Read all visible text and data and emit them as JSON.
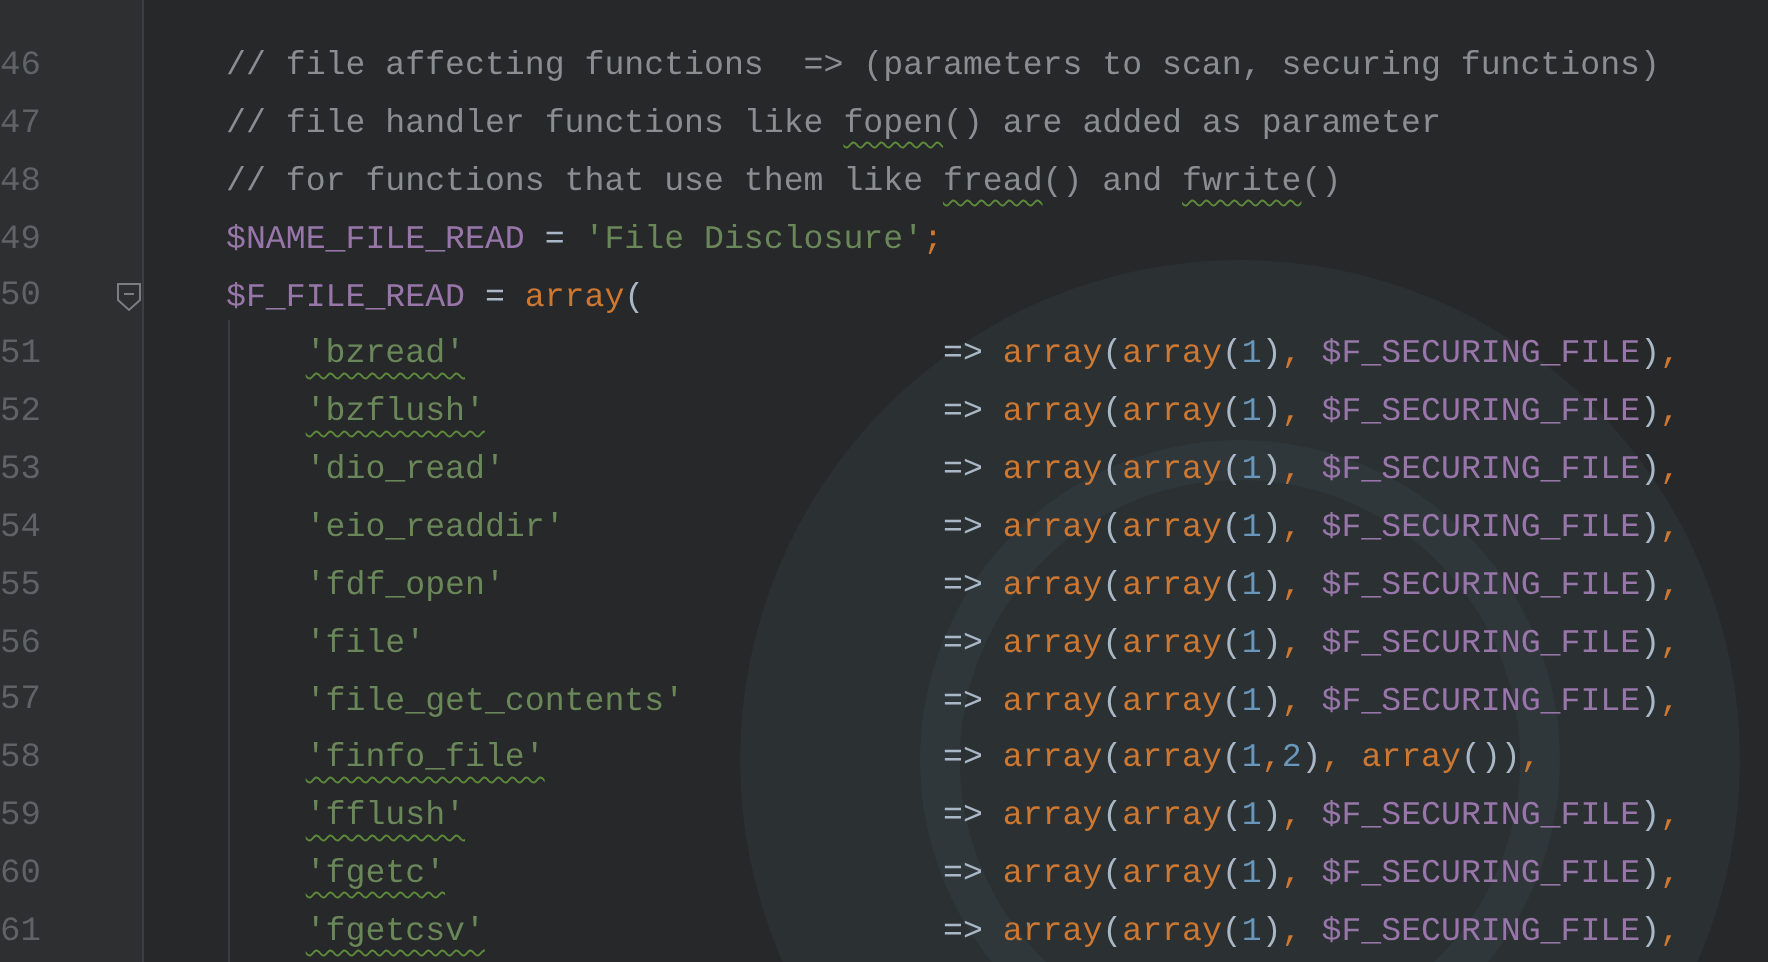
{
  "editor": {
    "lines": [
      {
        "number": "46",
        "fold_marker": false,
        "tokens": [
          {
            "kind": "comment",
            "text": "// file affecting functions  => (parameters to scan, securing functions)"
          }
        ]
      },
      {
        "number": "47",
        "fold_marker": false,
        "tokens": [
          {
            "kind": "comment",
            "text": "// file handler functions like "
          },
          {
            "kind": "flagged_comment",
            "text": "fopen"
          },
          {
            "kind": "comment",
            "text": "() are added as parameter"
          }
        ]
      },
      {
        "number": "48",
        "fold_marker": false,
        "tokens": [
          {
            "kind": "comment",
            "text": "// for functions that use them like "
          },
          {
            "kind": "flagged_comment",
            "text": "fread"
          },
          {
            "kind": "comment",
            "text": "() and "
          },
          {
            "kind": "flagged_comment",
            "text": "fwrite"
          },
          {
            "kind": "comment",
            "text": "()"
          }
        ]
      },
      {
        "number": "49",
        "fold_marker": false,
        "tokens": [
          {
            "kind": "variable",
            "text": "$NAME_FILE_READ"
          },
          {
            "kind": "plain",
            "text": " = "
          },
          {
            "kind": "string",
            "text": "'File Disclosure'"
          },
          {
            "kind": "keyword",
            "text": ";"
          }
        ]
      },
      {
        "number": "50",
        "fold_marker": true,
        "tokens": [
          {
            "kind": "variable",
            "text": "$F_FILE_READ"
          },
          {
            "kind": "plain",
            "text": " = "
          },
          {
            "kind": "keyword",
            "text": "array"
          },
          {
            "kind": "plain",
            "text": "("
          }
        ]
      },
      {
        "number": "51",
        "fold_marker": false,
        "tokens": [
          {
            "kind": "flagged_string",
            "text": "'bzread'"
          },
          {
            "kind": "plain",
            "text": "                        => "
          },
          {
            "kind": "keyword",
            "text": "array"
          },
          {
            "kind": "plain",
            "text": "("
          },
          {
            "kind": "keyword",
            "text": "array"
          },
          {
            "kind": "plain",
            "text": "("
          },
          {
            "kind": "number",
            "text": "1"
          },
          {
            "kind": "plain",
            "text": ")"
          },
          {
            "kind": "keyword",
            "text": ", "
          },
          {
            "kind": "variable",
            "text": "$F_SECURING_FILE"
          },
          {
            "kind": "plain",
            "text": ")"
          },
          {
            "kind": "keyword",
            "text": ","
          }
        ]
      },
      {
        "number": "52",
        "fold_marker": false,
        "tokens": [
          {
            "kind": "flagged_string",
            "text": "'bzflush'"
          },
          {
            "kind": "plain",
            "text": "                       => "
          },
          {
            "kind": "keyword",
            "text": "array"
          },
          {
            "kind": "plain",
            "text": "("
          },
          {
            "kind": "keyword",
            "text": "array"
          },
          {
            "kind": "plain",
            "text": "("
          },
          {
            "kind": "number",
            "text": "1"
          },
          {
            "kind": "plain",
            "text": ")"
          },
          {
            "kind": "keyword",
            "text": ", "
          },
          {
            "kind": "variable",
            "text": "$F_SECURING_FILE"
          },
          {
            "kind": "plain",
            "text": ")"
          },
          {
            "kind": "keyword",
            "text": ","
          }
        ]
      },
      {
        "number": "53",
        "fold_marker": false,
        "tokens": [
          {
            "kind": "string",
            "text": "'dio_read'"
          },
          {
            "kind": "plain",
            "text": "                      => "
          },
          {
            "kind": "keyword",
            "text": "array"
          },
          {
            "kind": "plain",
            "text": "("
          },
          {
            "kind": "keyword",
            "text": "array"
          },
          {
            "kind": "plain",
            "text": "("
          },
          {
            "kind": "number",
            "text": "1"
          },
          {
            "kind": "plain",
            "text": ")"
          },
          {
            "kind": "keyword",
            "text": ", "
          },
          {
            "kind": "variable",
            "text": "$F_SECURING_FILE"
          },
          {
            "kind": "plain",
            "text": ")"
          },
          {
            "kind": "keyword",
            "text": ","
          }
        ]
      },
      {
        "number": "54",
        "fold_marker": false,
        "tokens": [
          {
            "kind": "string",
            "text": "'eio_readdir'"
          },
          {
            "kind": "plain",
            "text": "                   => "
          },
          {
            "kind": "keyword",
            "text": "array"
          },
          {
            "kind": "plain",
            "text": "("
          },
          {
            "kind": "keyword",
            "text": "array"
          },
          {
            "kind": "plain",
            "text": "("
          },
          {
            "kind": "number",
            "text": "1"
          },
          {
            "kind": "plain",
            "text": ")"
          },
          {
            "kind": "keyword",
            "text": ", "
          },
          {
            "kind": "variable",
            "text": "$F_SECURING_FILE"
          },
          {
            "kind": "plain",
            "text": ")"
          },
          {
            "kind": "keyword",
            "text": ","
          }
        ]
      },
      {
        "number": "55",
        "fold_marker": false,
        "tokens": [
          {
            "kind": "string",
            "text": "'fdf_open'"
          },
          {
            "kind": "plain",
            "text": "                      => "
          },
          {
            "kind": "keyword",
            "text": "array"
          },
          {
            "kind": "plain",
            "text": "("
          },
          {
            "kind": "keyword",
            "text": "array"
          },
          {
            "kind": "plain",
            "text": "("
          },
          {
            "kind": "number",
            "text": "1"
          },
          {
            "kind": "plain",
            "text": ")"
          },
          {
            "kind": "keyword",
            "text": ", "
          },
          {
            "kind": "variable",
            "text": "$F_SECURING_FILE"
          },
          {
            "kind": "plain",
            "text": ")"
          },
          {
            "kind": "keyword",
            "text": ","
          }
        ]
      },
      {
        "number": "56",
        "fold_marker": false,
        "tokens": [
          {
            "kind": "string",
            "text": "'file'"
          },
          {
            "kind": "plain",
            "text": "                          => "
          },
          {
            "kind": "keyword",
            "text": "array"
          },
          {
            "kind": "plain",
            "text": "("
          },
          {
            "kind": "keyword",
            "text": "array"
          },
          {
            "kind": "plain",
            "text": "("
          },
          {
            "kind": "number",
            "text": "1"
          },
          {
            "kind": "plain",
            "text": ")"
          },
          {
            "kind": "keyword",
            "text": ", "
          },
          {
            "kind": "variable",
            "text": "$F_SECURING_FILE"
          },
          {
            "kind": "plain",
            "text": ")"
          },
          {
            "kind": "keyword",
            "text": ","
          }
        ]
      },
      {
        "number": "57",
        "fold_marker": false,
        "tokens": [
          {
            "kind": "string",
            "text": "'file_get_contents'"
          },
          {
            "kind": "plain",
            "text": "             => "
          },
          {
            "kind": "keyword",
            "text": "array"
          },
          {
            "kind": "plain",
            "text": "("
          },
          {
            "kind": "keyword",
            "text": "array"
          },
          {
            "kind": "plain",
            "text": "("
          },
          {
            "kind": "number",
            "text": "1"
          },
          {
            "kind": "plain",
            "text": ")"
          },
          {
            "kind": "keyword",
            "text": ", "
          },
          {
            "kind": "variable",
            "text": "$F_SECURING_FILE"
          },
          {
            "kind": "plain",
            "text": ")"
          },
          {
            "kind": "keyword",
            "text": ","
          }
        ]
      },
      {
        "number": "58",
        "fold_marker": false,
        "tokens": [
          {
            "kind": "flagged_string",
            "text": "'finfo_file'"
          },
          {
            "kind": "plain",
            "text": "                    => "
          },
          {
            "kind": "keyword",
            "text": "array"
          },
          {
            "kind": "plain",
            "text": "("
          },
          {
            "kind": "keyword",
            "text": "array"
          },
          {
            "kind": "plain",
            "text": "("
          },
          {
            "kind": "number",
            "text": "1"
          },
          {
            "kind": "keyword",
            "text": ","
          },
          {
            "kind": "number",
            "text": "2"
          },
          {
            "kind": "plain",
            "text": ")"
          },
          {
            "kind": "keyword",
            "text": ", "
          },
          {
            "kind": "keyword",
            "text": "array"
          },
          {
            "kind": "plain",
            "text": "())"
          },
          {
            "kind": "keyword",
            "text": ","
          }
        ]
      },
      {
        "number": "59",
        "fold_marker": false,
        "tokens": [
          {
            "kind": "flagged_string",
            "text": "'fflush'"
          },
          {
            "kind": "plain",
            "text": "                        => "
          },
          {
            "kind": "keyword",
            "text": "array"
          },
          {
            "kind": "plain",
            "text": "("
          },
          {
            "kind": "keyword",
            "text": "array"
          },
          {
            "kind": "plain",
            "text": "("
          },
          {
            "kind": "number",
            "text": "1"
          },
          {
            "kind": "plain",
            "text": ")"
          },
          {
            "kind": "keyword",
            "text": ", "
          },
          {
            "kind": "variable",
            "text": "$F_SECURING_FILE"
          },
          {
            "kind": "plain",
            "text": ")"
          },
          {
            "kind": "keyword",
            "text": ","
          }
        ]
      },
      {
        "number": "60",
        "fold_marker": false,
        "tokens": [
          {
            "kind": "flagged_string",
            "text": "'fgetc'"
          },
          {
            "kind": "plain",
            "text": "                         => "
          },
          {
            "kind": "keyword",
            "text": "array"
          },
          {
            "kind": "plain",
            "text": "("
          },
          {
            "kind": "keyword",
            "text": "array"
          },
          {
            "kind": "plain",
            "text": "("
          },
          {
            "kind": "number",
            "text": "1"
          },
          {
            "kind": "plain",
            "text": ")"
          },
          {
            "kind": "keyword",
            "text": ", "
          },
          {
            "kind": "variable",
            "text": "$F_SECURING_FILE"
          },
          {
            "kind": "plain",
            "text": ")"
          },
          {
            "kind": "keyword",
            "text": ","
          }
        ]
      },
      {
        "number": "61",
        "fold_marker": false,
        "tokens": [
          {
            "kind": "flagged_string",
            "text": "'fgetcsv'"
          },
          {
            "kind": "plain",
            "text": "                       => "
          },
          {
            "kind": "keyword",
            "text": "array"
          },
          {
            "kind": "plain",
            "text": "("
          },
          {
            "kind": "keyword",
            "text": "array"
          },
          {
            "kind": "plain",
            "text": "("
          },
          {
            "kind": "number",
            "text": "1"
          },
          {
            "kind": "plain",
            "text": ")"
          },
          {
            "kind": "keyword",
            "text": ", "
          },
          {
            "kind": "variable",
            "text": "$F_SECURING_FILE"
          },
          {
            "kind": "plain",
            "text": ")"
          },
          {
            "kind": "keyword",
            "text": ","
          }
        ]
      }
    ]
  }
}
